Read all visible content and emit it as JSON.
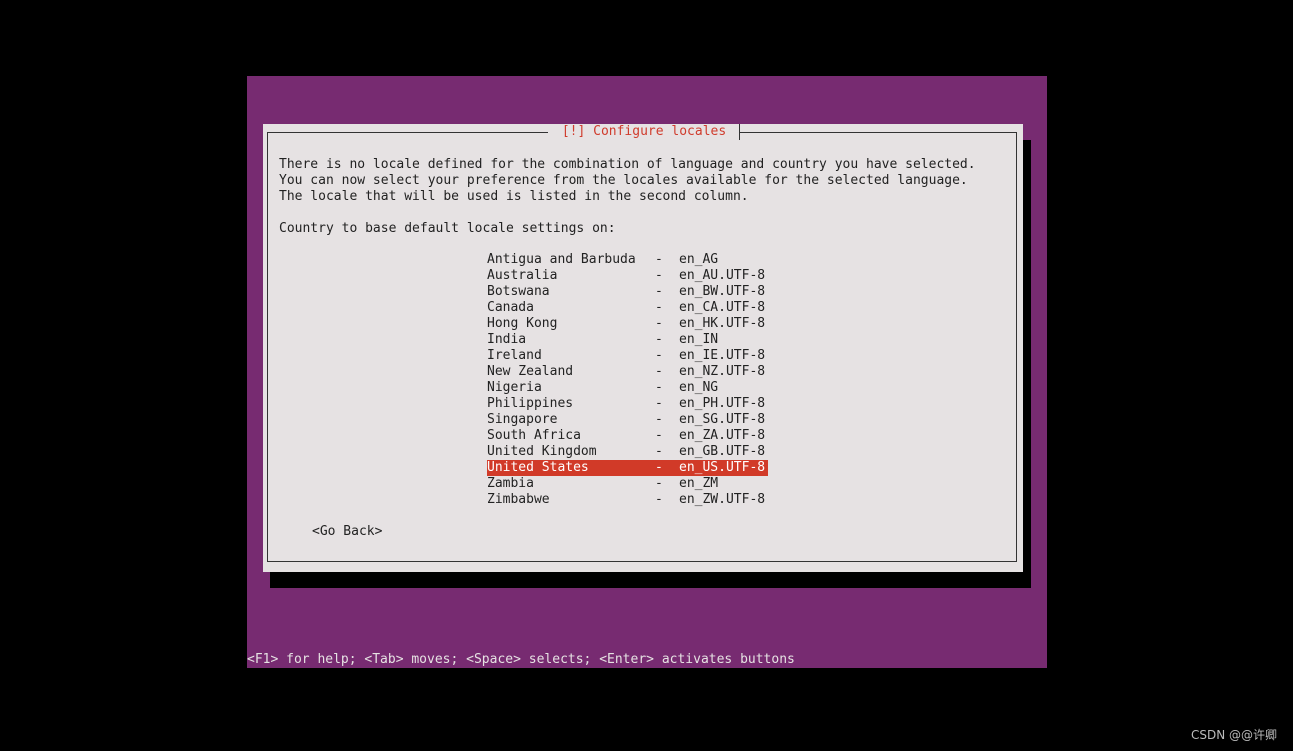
{
  "dialog": {
    "title": "[!] Configure locales",
    "description": [
      "There is no locale defined for the combination of language and country you have selected.",
      "You can now select your preference from the locales available for the selected language.",
      "The locale that will be used is listed in the second column."
    ],
    "prompt": "Country to base default locale settings on:",
    "locales": [
      {
        "country": "Antigua and Barbuda",
        "locale": "en_AG"
      },
      {
        "country": "Australia",
        "locale": "en_AU.UTF-8"
      },
      {
        "country": "Botswana",
        "locale": "en_BW.UTF-8"
      },
      {
        "country": "Canada",
        "locale": "en_CA.UTF-8"
      },
      {
        "country": "Hong Kong",
        "locale": "en_HK.UTF-8"
      },
      {
        "country": "India",
        "locale": "en_IN"
      },
      {
        "country": "Ireland",
        "locale": "en_IE.UTF-8"
      },
      {
        "country": "New Zealand",
        "locale": "en_NZ.UTF-8"
      },
      {
        "country": "Nigeria",
        "locale": "en_NG"
      },
      {
        "country": "Philippines",
        "locale": "en_PH.UTF-8"
      },
      {
        "country": "Singapore",
        "locale": "en_SG.UTF-8"
      },
      {
        "country": "South Africa",
        "locale": "en_ZA.UTF-8"
      },
      {
        "country": "United Kingdom",
        "locale": "en_GB.UTF-8"
      },
      {
        "country": "United States",
        "locale": "en_US.UTF-8",
        "selected": true
      },
      {
        "country": "Zambia",
        "locale": "en_ZM"
      },
      {
        "country": "Zimbabwe",
        "locale": "en_ZW.UTF-8"
      }
    ],
    "separator": "-",
    "go_back_label": "<Go Back>"
  },
  "help_bar": "<F1> for help; <Tab> moves; <Space> selects; <Enter> activates buttons",
  "watermark": "CSDN @@许卿",
  "colors": {
    "screen_bg": "#772b71",
    "dialog_bg": "#e6e2e3",
    "title_color": "#d03c2d",
    "selection_bg": "#d13a28"
  }
}
